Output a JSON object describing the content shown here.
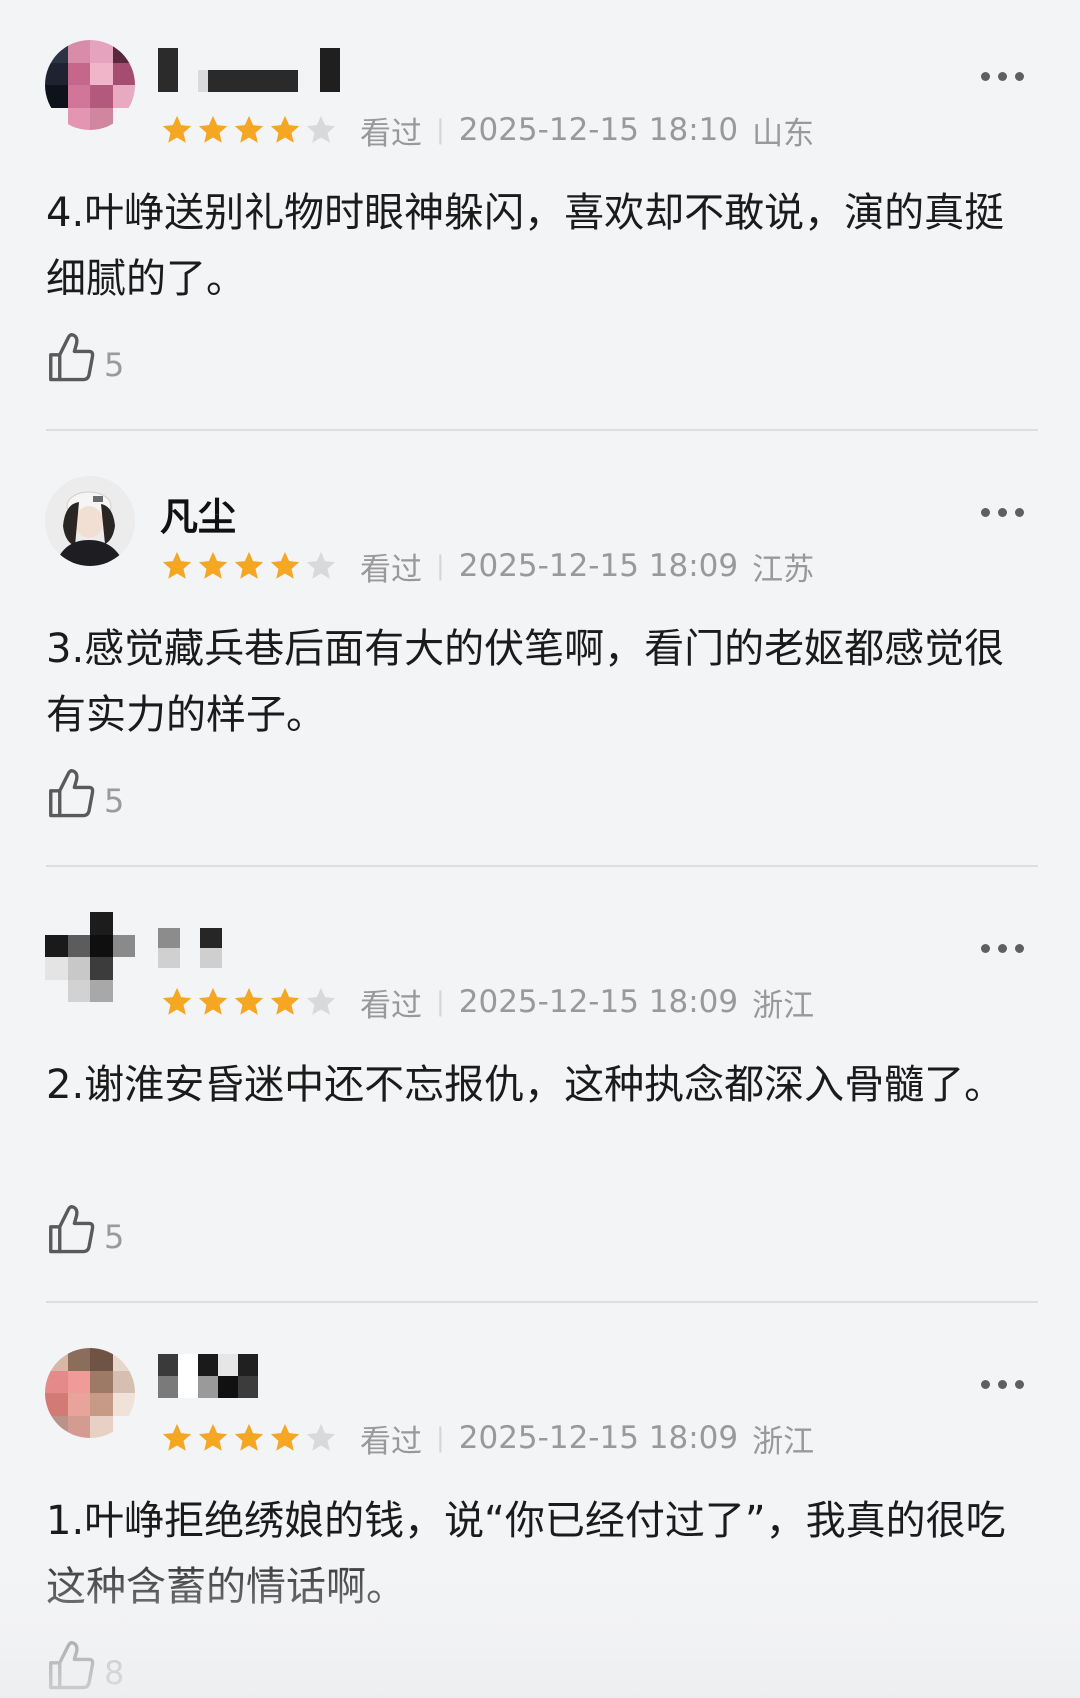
{
  "reviews": [
    {
      "user_name": "",
      "name_redacted": true,
      "watch_status": "看过",
      "date": "2025-12-15 18:10",
      "location": "山东",
      "stars_filled": 4,
      "stars_total": 5,
      "text": "4.叶峥送别礼物时眼神躲闪，喜欢却不敢说，演的真挺细腻的了。",
      "likes": "5"
    },
    {
      "user_name": "凡尘",
      "name_redacted": false,
      "watch_status": "看过",
      "date": "2025-12-15 18:09",
      "location": "江苏",
      "stars_filled": 4,
      "stars_total": 5,
      "text": "3.感觉藏兵巷后面有大的伏笔啊，看门的老妪都感觉很有实力的样子。",
      "likes": "5"
    },
    {
      "user_name": "",
      "name_redacted": true,
      "watch_status": "看过",
      "date": "2025-12-15 18:09",
      "location": "浙江",
      "stars_filled": 4,
      "stars_total": 5,
      "text": "2.谢淮安昏迷中还不忘报仇，这种执念都深入骨髓了。",
      "likes": "5"
    },
    {
      "user_name": "",
      "name_redacted": true,
      "watch_status": "看过",
      "date": "2025-12-15 18:09",
      "location": "浙江",
      "stars_filled": 4,
      "stars_total": 5,
      "text": "1.叶峥拒绝绣娘的钱，说“你已经付过了”，我真的很吃这种含蓄的情话啊。",
      "likes": "8"
    }
  ],
  "colors": {
    "star_filled": "#f5a623",
    "star_empty": "#d9d9d9",
    "meta_text": "#999999",
    "divider": "#dedede"
  },
  "icons": {
    "like": "thumbs-up-icon",
    "more": "more-dots-icon",
    "star": "star-icon"
  }
}
